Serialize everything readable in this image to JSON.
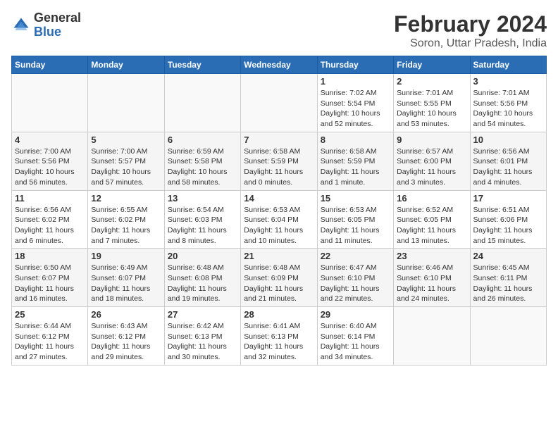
{
  "logo": {
    "general": "General",
    "blue": "Blue"
  },
  "title": "February 2024",
  "subtitle": "Soron, Uttar Pradesh, India",
  "weekdays": [
    "Sunday",
    "Monday",
    "Tuesday",
    "Wednesday",
    "Thursday",
    "Friday",
    "Saturday"
  ],
  "weeks": [
    [
      {
        "day": "",
        "info": ""
      },
      {
        "day": "",
        "info": ""
      },
      {
        "day": "",
        "info": ""
      },
      {
        "day": "",
        "info": ""
      },
      {
        "day": "1",
        "info": "Sunrise: 7:02 AM\nSunset: 5:54 PM\nDaylight: 10 hours and 52 minutes."
      },
      {
        "day": "2",
        "info": "Sunrise: 7:01 AM\nSunset: 5:55 PM\nDaylight: 10 hours and 53 minutes."
      },
      {
        "day": "3",
        "info": "Sunrise: 7:01 AM\nSunset: 5:56 PM\nDaylight: 10 hours and 54 minutes."
      }
    ],
    [
      {
        "day": "4",
        "info": "Sunrise: 7:00 AM\nSunset: 5:56 PM\nDaylight: 10 hours and 56 minutes."
      },
      {
        "day": "5",
        "info": "Sunrise: 7:00 AM\nSunset: 5:57 PM\nDaylight: 10 hours and 57 minutes."
      },
      {
        "day": "6",
        "info": "Sunrise: 6:59 AM\nSunset: 5:58 PM\nDaylight: 10 hours and 58 minutes."
      },
      {
        "day": "7",
        "info": "Sunrise: 6:58 AM\nSunset: 5:59 PM\nDaylight: 11 hours and 0 minutes."
      },
      {
        "day": "8",
        "info": "Sunrise: 6:58 AM\nSunset: 5:59 PM\nDaylight: 11 hours and 1 minute."
      },
      {
        "day": "9",
        "info": "Sunrise: 6:57 AM\nSunset: 6:00 PM\nDaylight: 11 hours and 3 minutes."
      },
      {
        "day": "10",
        "info": "Sunrise: 6:56 AM\nSunset: 6:01 PM\nDaylight: 11 hours and 4 minutes."
      }
    ],
    [
      {
        "day": "11",
        "info": "Sunrise: 6:56 AM\nSunset: 6:02 PM\nDaylight: 11 hours and 6 minutes."
      },
      {
        "day": "12",
        "info": "Sunrise: 6:55 AM\nSunset: 6:02 PM\nDaylight: 11 hours and 7 minutes."
      },
      {
        "day": "13",
        "info": "Sunrise: 6:54 AM\nSunset: 6:03 PM\nDaylight: 11 hours and 8 minutes."
      },
      {
        "day": "14",
        "info": "Sunrise: 6:53 AM\nSunset: 6:04 PM\nDaylight: 11 hours and 10 minutes."
      },
      {
        "day": "15",
        "info": "Sunrise: 6:53 AM\nSunset: 6:05 PM\nDaylight: 11 hours and 11 minutes."
      },
      {
        "day": "16",
        "info": "Sunrise: 6:52 AM\nSunset: 6:05 PM\nDaylight: 11 hours and 13 minutes."
      },
      {
        "day": "17",
        "info": "Sunrise: 6:51 AM\nSunset: 6:06 PM\nDaylight: 11 hours and 15 minutes."
      }
    ],
    [
      {
        "day": "18",
        "info": "Sunrise: 6:50 AM\nSunset: 6:07 PM\nDaylight: 11 hours and 16 minutes."
      },
      {
        "day": "19",
        "info": "Sunrise: 6:49 AM\nSunset: 6:07 PM\nDaylight: 11 hours and 18 minutes."
      },
      {
        "day": "20",
        "info": "Sunrise: 6:48 AM\nSunset: 6:08 PM\nDaylight: 11 hours and 19 minutes."
      },
      {
        "day": "21",
        "info": "Sunrise: 6:48 AM\nSunset: 6:09 PM\nDaylight: 11 hours and 21 minutes."
      },
      {
        "day": "22",
        "info": "Sunrise: 6:47 AM\nSunset: 6:10 PM\nDaylight: 11 hours and 22 minutes."
      },
      {
        "day": "23",
        "info": "Sunrise: 6:46 AM\nSunset: 6:10 PM\nDaylight: 11 hours and 24 minutes."
      },
      {
        "day": "24",
        "info": "Sunrise: 6:45 AM\nSunset: 6:11 PM\nDaylight: 11 hours and 26 minutes."
      }
    ],
    [
      {
        "day": "25",
        "info": "Sunrise: 6:44 AM\nSunset: 6:12 PM\nDaylight: 11 hours and 27 minutes."
      },
      {
        "day": "26",
        "info": "Sunrise: 6:43 AM\nSunset: 6:12 PM\nDaylight: 11 hours and 29 minutes."
      },
      {
        "day": "27",
        "info": "Sunrise: 6:42 AM\nSunset: 6:13 PM\nDaylight: 11 hours and 30 minutes."
      },
      {
        "day": "28",
        "info": "Sunrise: 6:41 AM\nSunset: 6:13 PM\nDaylight: 11 hours and 32 minutes."
      },
      {
        "day": "29",
        "info": "Sunrise: 6:40 AM\nSunset: 6:14 PM\nDaylight: 11 hours and 34 minutes."
      },
      {
        "day": "",
        "info": ""
      },
      {
        "day": "",
        "info": ""
      }
    ]
  ]
}
